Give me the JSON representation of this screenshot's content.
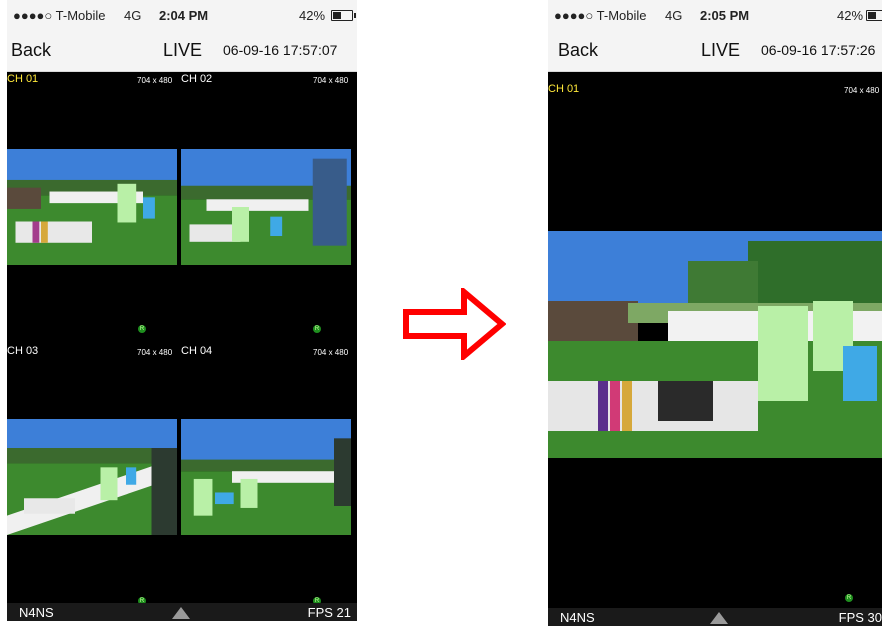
{
  "left": {
    "status": {
      "carrier": "●●●●○ T-Mobile",
      "network": "4G",
      "time": "2:04 PM",
      "battery": "42%"
    },
    "nav": {
      "back": "Back",
      "title": "LIVE",
      "timestamp": "06-09-16 17:57:07"
    },
    "channels": [
      {
        "label": "CH 01",
        "resolution": "704 x 480",
        "active": true
      },
      {
        "label": "CH 02",
        "resolution": "704 x 480",
        "active": false
      },
      {
        "label": "CH 03",
        "resolution": "704 x 480",
        "active": false
      },
      {
        "label": "CH 04",
        "resolution": "704 x 480",
        "active": false
      }
    ],
    "rec_badge": "R",
    "bottom": {
      "device": "N4NS",
      "fps": "FPS 21"
    }
  },
  "right": {
    "status": {
      "carrier": "●●●●○ T-Mobile",
      "network": "4G",
      "time": "2:05 PM",
      "battery": "42%"
    },
    "nav": {
      "back": "Back",
      "title": "LIVE",
      "timestamp": "06-09-16 17:57:26"
    },
    "channel": {
      "label": "CH 01",
      "resolution": "704 x 480",
      "active": true
    },
    "rec_badge": "R",
    "bottom": {
      "device": "N4NS",
      "fps": "FPS 30"
    }
  },
  "colors": {
    "arrow": "#ff0000",
    "active_channel": "#ffe83a",
    "rec": "#1f8f1f"
  },
  "icons": {
    "transition": "right-arrow-icon",
    "bottom_toggle": "up-triangle-icon",
    "battery": "battery-icon"
  }
}
